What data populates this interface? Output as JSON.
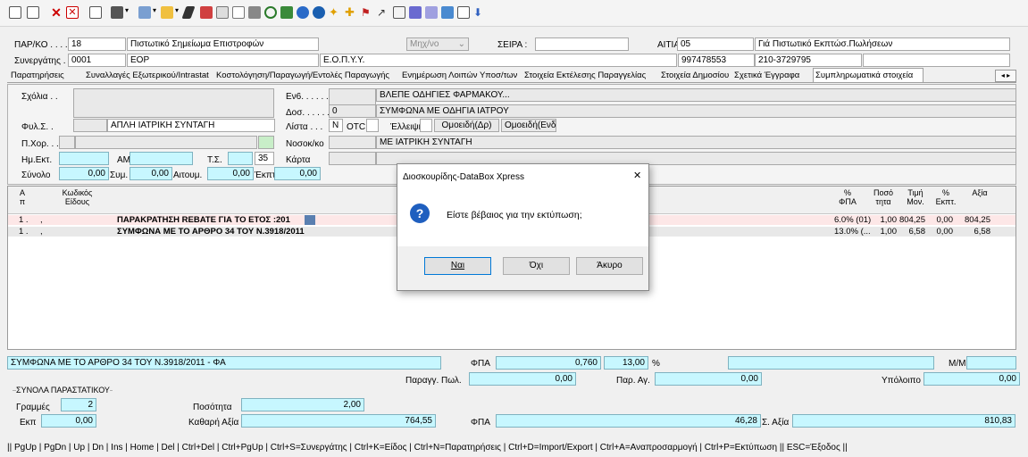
{
  "toolbar": {
    "icons": [
      "new-doc-icon",
      "edit-icon",
      "delete-icon",
      "close-box-icon",
      "preview-icon",
      "print-icon",
      "dropdown-icon",
      "tools-icon",
      "dropdown-icon",
      "folder-icon",
      "dropdown-icon",
      "pencil-icon",
      "stamp-icon",
      "table-icon",
      "doc-icon",
      "printer-icon",
      "search-icon",
      "chart-icon",
      "reload-icon",
      "globe-icon",
      "star-icon",
      "filter-icon",
      "pin-icon",
      "cursor-icon",
      "lock-icon",
      "users-icon",
      "report-icon",
      "grid-icon",
      "window-icon",
      "download-icon"
    ]
  },
  "header": {
    "par_ko_label": "ΠΑΡ/ΚΟ . . . . . . .",
    "par_ko_value": "18",
    "doc_type": "Πιστωτικό Σημείωμα Επιστροφών",
    "mhx": "Μηχ/νο",
    "seira_label": "ΣΕΙΡΑ :",
    "seira_value": "",
    "aitia_label": "ΑΙΤΙΑ :",
    "aitia_value": "05",
    "aitia_desc": "Γιά Πιστωτικό Εκπτώσ.Πωλήσεων",
    "synergatis_label": "Συνεργάτης . . . .",
    "synergatis_code": "0001",
    "synergatis_name": "ΕΟΡ",
    "synergatis_org": "Ε.Ο.Π.Υ.Υ.",
    "afm": "997478553",
    "phone": "210-3729795"
  },
  "tabs": [
    "Παρατηρήσεις",
    "Συναλλαγές Εξωτερικού/Intrastat",
    "Κοστολόγηση/Παραγωγή/Εντολές Παραγωγής",
    "Ενημέρωση Λοιπών Υποσ/των",
    "Στοιχεία Εκτέλεσης Παραγγελίας",
    "Στοιχεία Δημοσίου",
    "Σχετικά Έγγραφα",
    "Συμπληρωματικά στοιχεία"
  ],
  "form": {
    "scholia_label": "Σχόλια . .",
    "ev6_label": "Εν6. . . . . .",
    "ev6_value": "ΒΛΕΠΕ ΟΔΗΓΙΕΣ ΦΑΡΜΑΚΟΥ...",
    "dos_label": "Δοσ. . . . . .",
    "dos_value": "0",
    "dos_text": "ΣΥΜΦΩΝΑ ΜΕ ΟΔΗΓΙΑ ΙΑΤΡΟΥ",
    "fyl_label": "Φυλ.Σ. .",
    "fyl_value": "ΑΠΛΗ ΙΑΤΡΙΚΗ ΣΥΝΤΑΓΗ",
    "lista_label": "Λίστα . . .",
    "lista_value": "N",
    "otc_label": "OTC.",
    "elleipsi_label": "Έλλειψη .",
    "omoeidi_dr": "Ομοειδή(Δρ)",
    "omoeidi_ev": "Ομοειδή(Ενδ)",
    "pxor_label": "Π.Χορ. . .",
    "nosok_label": "Νοσοκ/κο",
    "nosok_value": "ΜΕ ΙΑΤΡΙΚΗ ΣΥΝΤΑΓΗ",
    "hm_label": "Ημ.Εκτ.",
    "am_label": "ΑΜ",
    "ts_label": "Τ.Σ.",
    "ts_value": "35",
    "karta_label": "Κάρτα",
    "synolo_label": "Σύνολο",
    "synolo_value": "0,00",
    "sym_label": "Συμ.",
    "sym_value": "0,00",
    "aitoum_label": "Αιτουμ.",
    "aitoum_value": "0,00",
    "ekpt_label": "Έκπτ.",
    "ekpt_value": "0,00"
  },
  "grid": {
    "headers": {
      "a": "A\nπ",
      "kodikos": "Κωδικός\nΕίδους",
      "fpa": "%\nΦΠΑ",
      "posotita": "Ποσό\nτητα",
      "timi": "Τιμή\nΜον.",
      "ekpt": "%\nΕκπτ.",
      "axia": "Αξία"
    },
    "rows": [
      {
        "a": "1 .",
        "sep": ",",
        "desc": "ΠΑΡΑΚΡΑΤΗΣΗ REBATE ΓΙΑ ΤΟ ΕΤΟΣ :201",
        "fpa": "6.0% (01)",
        "qty": "1,00",
        "price": "804,25",
        "disc": "0,00",
        "value": "804,25"
      },
      {
        "a": "1 .",
        "sep": ",",
        "desc": "ΣΥΜΦΩΝΑ ΜΕ ΤΟ ΑΡΘΡΟ 34 ΤΟΥ Ν.3918/2011",
        "fpa": "13.0% (...",
        "qty": "1,00",
        "price": "6,58",
        "disc": "0,00",
        "value": "6,58"
      }
    ]
  },
  "footer": {
    "item_text": "ΣΥΜΦΩΝΑ ΜΕ ΤΟ ΑΡΘΡΟ 34 ΤΟΥ Ν.3918/2011 - ΦΑ",
    "fpa_label": "ΦΠΑ",
    "fpa_value": "0,760",
    "fpa_pct": "13,00",
    "pct_sign": "%",
    "mm_label": "Μ/Μ",
    "parag_label": "Παραγγ. Πωλ.",
    "parag_value": "0,00",
    "par_ag_label": "Παρ. Αγ.",
    "par_ag_value": "0,00",
    "ypoloipo_label": "Υπόλοιπο",
    "ypoloipo_value": "0,00",
    "synola_label": "ΣΥΝΟΛΑ ΠΑΡΑΣΤΑΤΙΚΟΥ",
    "grammes_label": "Γραμμές",
    "grammes_value": "2",
    "posotita_label": "Ποσότητα",
    "posotita_value": "2,00",
    "ekp_label": "Εκπ",
    "ekp_value": "0,00",
    "kathari_label": "Καθαρή Αξία",
    "kathari_value": "764,55",
    "fpa2_label": "ΦΠΑ",
    "fpa2_value": "46,28",
    "s_axia_label": "Σ. Αξία",
    "s_axia_value": "810,83"
  },
  "status": "|| PgUp | PgDn | Up | Dn | Ins | Home | Del | Ctrl+Del | Ctrl+PgUp | Ctrl+S=Συνεργάτης | Ctrl+K=Είδος | Ctrl+N=Παρατηρήσεις | Ctrl+D=Import/Export | Ctrl+A=Αναπροσαρμογή | Ctrl+P=Εκτύπωση || ESC=Έξοδος ||",
  "dialog": {
    "title": "Διοσκουρίδης-DataBox Xpress",
    "message": "Είστε βέβαιος για την εκτύπωση;",
    "btn_yes": "Ναι",
    "btn_no": "Όχι",
    "btn_cancel": "Άκυρο",
    "close": "✕"
  }
}
